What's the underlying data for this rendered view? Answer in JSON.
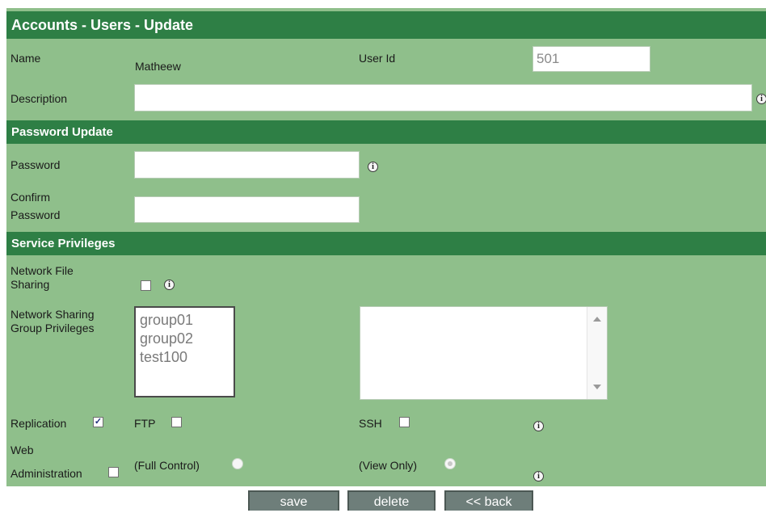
{
  "page": {
    "title": "Accounts - Users - Update"
  },
  "user": {
    "name_label": "Name",
    "name_value": "Matheew",
    "userid_label": "User Id",
    "userid_value": "501",
    "description_label": "Description",
    "description_value": ""
  },
  "password_section": {
    "title": "Password Update",
    "password_label": "Password",
    "confirm_label_line1": "Confirm",
    "confirm_label_line2": "Password"
  },
  "privileges_section": {
    "title": "Service Privileges",
    "nfs_label_line1": "Network File",
    "nfs_label_line2": "Sharing",
    "nfs_checked": false,
    "group_label_line1": "Network Sharing",
    "group_label_line2": "Group Privileges",
    "groups": [
      "group01",
      "group02",
      "test100"
    ],
    "replication_label": "Replication",
    "replication_checked": true,
    "ftp_label": "FTP",
    "ftp_checked": false,
    "ssh_label": "SSH",
    "ssh_checked": false,
    "web_label_line1": "Web",
    "web_label_line2": "Administration",
    "web_checked": false,
    "full_control_label": "(Full Control)",
    "view_only_label": "(View Only)"
  },
  "buttons": {
    "save": "save",
    "delete": "delete",
    "back": "<< back"
  },
  "colors": {
    "panel_bg": "#8fbf8b",
    "header_bg": "#2e7f45",
    "button_bg": "#6e7e7a"
  },
  "icons": {
    "info": "info-icon",
    "checkmark": "check-icon"
  }
}
